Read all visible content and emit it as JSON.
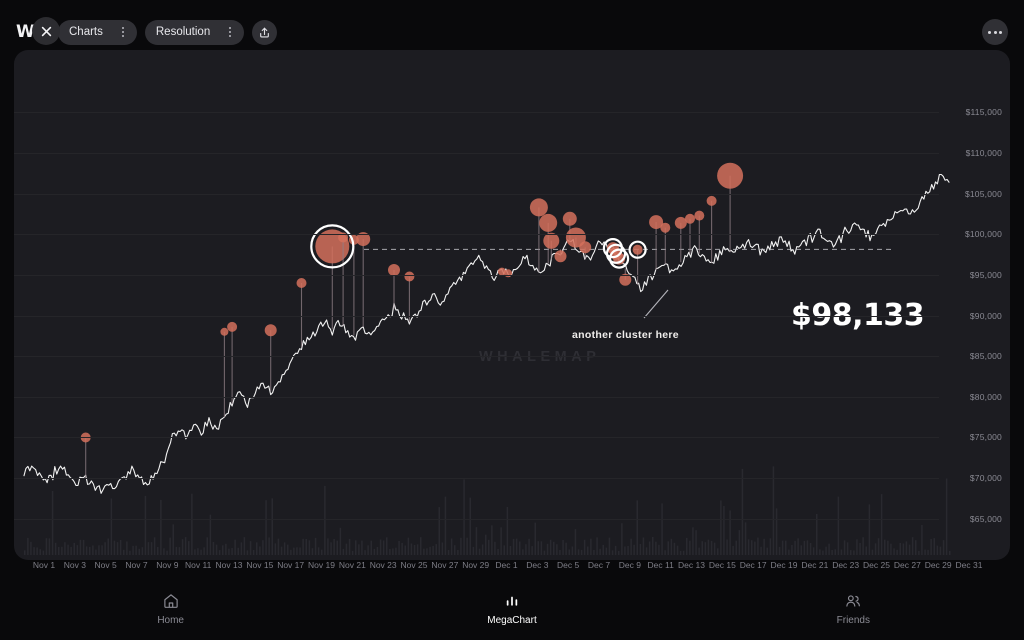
{
  "app": {
    "logo_text": "W",
    "logo_close_icon": "close-icon"
  },
  "toolbar": {
    "charts_label": "Charts",
    "resolution_label": "Resolution",
    "share_icon": "share-upload-icon",
    "more_icon": "more-horizontal-icon"
  },
  "chart": {
    "watermark": "WHALEMAP",
    "price_label": "$98,133",
    "annotation": "another cluster here",
    "bubble_color": "#d4705c",
    "line_color": "#f2f2f2",
    "panel_color": "#1c1c21",
    "highlight_color": "#ffffff"
  },
  "bottom_nav": {
    "items": [
      {
        "label": "Home",
        "icon": "home-icon",
        "active": false
      },
      {
        "label": "MegaChart",
        "icon": "bar-chart-icon",
        "active": true
      },
      {
        "label": "Friends",
        "icon": "users-icon",
        "active": false
      }
    ]
  },
  "chart_data": {
    "type": "line",
    "title": "",
    "subtitle": "",
    "xlabel": "",
    "ylabel": "",
    "grid": true,
    "legend": false,
    "ylim": [
      63000,
      117500
    ],
    "ytick_labels": [
      "$115,000",
      "$110,000",
      "$105,000",
      "$100,000",
      "$95,000",
      "$90,000",
      "$85,000",
      "$80,000",
      "$75,000",
      "$70,000",
      "$65,000"
    ],
    "ytick_values": [
      115000,
      110000,
      105000,
      100000,
      95000,
      90000,
      85000,
      80000,
      75000,
      70000,
      65000
    ],
    "xtick_labels": [
      "Nov 1",
      "Nov 3",
      "Nov 5",
      "Nov 7",
      "Nov 9",
      "Nov 11",
      "Nov 13",
      "Nov 15",
      "Nov 17",
      "Nov 19",
      "Nov 21",
      "Nov 23",
      "Nov 25",
      "Nov 27",
      "Nov 29",
      "Dec 1",
      "Dec 3",
      "Dec 5",
      "Dec 7",
      "Dec 9",
      "Dec 11",
      "Dec 13",
      "Dec 15",
      "Dec 17",
      "Dec 19",
      "Dec 21",
      "Dec 23",
      "Dec 25",
      "Dec 27",
      "Dec 29",
      "Dec 31"
    ],
    "current_price": 98133,
    "reference_line": 98133,
    "series": [
      {
        "name": "Price",
        "color": "#f2f2f2",
        "x": [
          0,
          0.5,
          1,
          1.5,
          2,
          2.5,
          3,
          3.5,
          4,
          4.5,
          5,
          5.5,
          6,
          6.5,
          7,
          7.5,
          8,
          8.5,
          9,
          9.5,
          10,
          10.5,
          11,
          11.5,
          12,
          12.5,
          13,
          13.5,
          14,
          14.5,
          15,
          15.5,
          16,
          16.5,
          17,
          17.5,
          18,
          18.5,
          19,
          19.5,
          20,
          20.5,
          21,
          21.5,
          22,
          22.5,
          23,
          23.5,
          24,
          24.5,
          25,
          25.5,
          26,
          26.5,
          27,
          27.5,
          28,
          28.5,
          29,
          29.5,
          30,
          30.5,
          31,
          31.5,
          32,
          32.5,
          33,
          33.5,
          34,
          34.5,
          35,
          35.5,
          36,
          36.5,
          37,
          37.5,
          38,
          38.5,
          39,
          39.5,
          40,
          40.5,
          41,
          41.5,
          42,
          42.5,
          43,
          43.5,
          44,
          44.5,
          45,
          45.5,
          46,
          46.5,
          47,
          47.5,
          48,
          48.5,
          49,
          49.5,
          50,
          50.5,
          51,
          51.5,
          52,
          52.5,
          53,
          53.5,
          54,
          54.5,
          55,
          55.5,
          56,
          56.5,
          57,
          57.5,
          58,
          58.5,
          59,
          59.5,
          60
        ],
        "values": [
          70500,
          71200,
          70400,
          69600,
          70800,
          71400,
          70200,
          69400,
          70000,
          69100,
          68800,
          69500,
          68900,
          69900,
          71100,
          70100,
          69300,
          70500,
          71900,
          74800,
          76200,
          75100,
          76400,
          75600,
          77100,
          76200,
          77500,
          79100,
          80400,
          79300,
          80900,
          81800,
          80700,
          81900,
          83200,
          84800,
          86100,
          87200,
          88500,
          89400,
          88300,
          89100,
          88200,
          87400,
          88600,
          87800,
          88900,
          89700,
          90800,
          90000,
          89200,
          90400,
          91500,
          92300,
          91400,
          92600,
          93800,
          95100,
          96300,
          97100,
          95800,
          94200,
          95600,
          94800,
          96100,
          97300,
          96200,
          95100,
          96400,
          97600,
          98500,
          99100,
          97900,
          96800,
          98100,
          99200,
          98300,
          97100,
          95800,
          94600,
          93200,
          94400,
          95600,
          96500,
          95300,
          96400,
          97200,
          98100,
          97300,
          96200,
          97400,
          98200,
          97500,
          98400,
          99100,
          98300,
          97600,
          98500,
          99300,
          98700,
          97900,
          98800,
          99500,
          100200,
          99400,
          98600,
          99700,
          100500,
          101300,
          100400,
          99600,
          100800,
          101700,
          102600,
          103400,
          102500,
          103600,
          104800,
          105900,
          107200,
          106400
        ]
      }
    ],
    "volume": {
      "name": "Volume",
      "color": "#2b2b31",
      "note": "faint vertical bars along the bottom of the plot"
    },
    "bubbles": [
      {
        "x": "Nov 5",
        "y": 75000,
        "r": 5
      },
      {
        "x": "Nov 14",
        "y": 88000,
        "r": 4
      },
      {
        "x": "Nov 14.5",
        "y": 88600,
        "r": 5
      },
      {
        "x": "Nov 17",
        "y": 88200,
        "r": 6
      },
      {
        "x": "Nov 19",
        "y": 94000,
        "r": 5
      },
      {
        "x": "Nov 21",
        "y": 98500,
        "r": 17,
        "highlight": true,
        "highlight_r": 21
      },
      {
        "x": "Nov 21.7",
        "y": 99600,
        "r": 5
      },
      {
        "x": "Nov 22.4",
        "y": 99300,
        "r": 5
      },
      {
        "x": "Nov 23",
        "y": 99400,
        "r": 7
      },
      {
        "x": "Nov 25",
        "y": 95600,
        "r": 6
      },
      {
        "x": "Nov 26",
        "y": 94800,
        "r": 5
      },
      {
        "x": "Dec 2",
        "y": 95400,
        "r": 4
      },
      {
        "x": "Dec 2.4",
        "y": 95200,
        "r": 4
      },
      {
        "x": "Dec 4.4",
        "y": 103300,
        "r": 9
      },
      {
        "x": "Dec 5",
        "y": 101400,
        "r": 9
      },
      {
        "x": "Dec 5.2",
        "y": 99200,
        "r": 8
      },
      {
        "x": "Dec 5.8",
        "y": 97300,
        "r": 6
      },
      {
        "x": "Dec 6.4",
        "y": 101900,
        "r": 7
      },
      {
        "x": "Dec 6.8",
        "y": 99600,
        "r": 10
      },
      {
        "x": "Dec 7.4",
        "y": 98400,
        "r": 6
      },
      {
        "x": "Dec 9.2",
        "y": 98300,
        "r": 6,
        "highlight": true,
        "highlight_r": 9
      },
      {
        "x": "Dec 9.4",
        "y": 97600,
        "r": 6,
        "highlight": true,
        "highlight_r": 9
      },
      {
        "x": "Dec 9.6",
        "y": 97000,
        "r": 6,
        "highlight": true,
        "highlight_r": 9
      },
      {
        "x": "Dec 10",
        "y": 94400,
        "r": 6
      },
      {
        "x": "Dec 10.8",
        "y": 98100,
        "r": 5,
        "highlight": true,
        "highlight_r": 8
      },
      {
        "x": "Dec 12",
        "y": 101500,
        "r": 7
      },
      {
        "x": "Dec 12.6",
        "y": 100800,
        "r": 5
      },
      {
        "x": "Dec 13.6",
        "y": 101400,
        "r": 6
      },
      {
        "x": "Dec 14.2",
        "y": 101900,
        "r": 5
      },
      {
        "x": "Dec 14.8",
        "y": 102300,
        "r": 5
      },
      {
        "x": "Dec 15.6",
        "y": 104100,
        "r": 5
      },
      {
        "x": "Dec 16.8",
        "y": 107200,
        "r": 13
      }
    ]
  }
}
